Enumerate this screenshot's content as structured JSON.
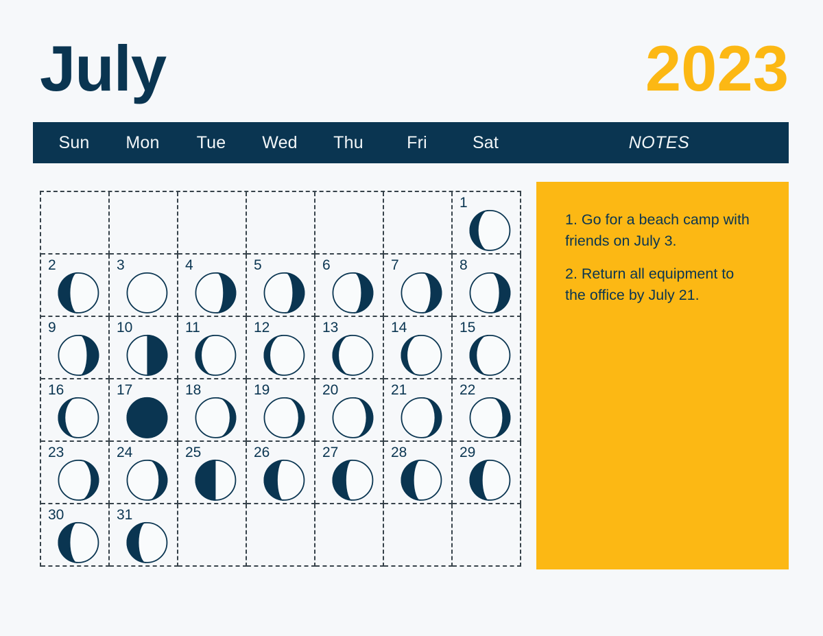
{
  "header": {
    "month": "July",
    "year": "2023",
    "notes_label": "NOTES",
    "weekdays": [
      "Sun",
      "Mon",
      "Tue",
      "Wed",
      "Thu",
      "Fri",
      "Sat"
    ]
  },
  "colors": {
    "navy": "#0a3551",
    "amber": "#fcb814",
    "background": "#f6f8fa",
    "grid_line": "#36424a"
  },
  "notes": {
    "items": [
      "1. Go for a beach camp with friends on July 3.",
      "2. Return all equipment to the office by July 21."
    ]
  },
  "calendar": {
    "leading_blanks": 6,
    "trailing_blanks": 5,
    "days": [
      {
        "num": "1",
        "phase": "waning-crescent",
        "illumination": 0.22,
        "dark_side": "left"
      },
      {
        "num": "2",
        "phase": "waning-crescent",
        "illumination": 0.3,
        "dark_side": "left"
      },
      {
        "num": "3",
        "phase": "full-moon",
        "illumination": 1.0,
        "dark_side": "none"
      },
      {
        "num": "4",
        "phase": "waning-gibbous",
        "illumination": 0.32,
        "dark_side": "right"
      },
      {
        "num": "5",
        "phase": "waning-gibbous",
        "illumination": 0.3,
        "dark_side": "right"
      },
      {
        "num": "6",
        "phase": "waning-gibbous",
        "illumination": 0.3,
        "dark_side": "right"
      },
      {
        "num": "7",
        "phase": "waning-gibbous",
        "illumination": 0.28,
        "dark_side": "right"
      },
      {
        "num": "8",
        "phase": "waning-gibbous",
        "illumination": 0.28,
        "dark_side": "right"
      },
      {
        "num": "9",
        "phase": "waning-gibbous",
        "illumination": 0.3,
        "dark_side": "right"
      },
      {
        "num": "10",
        "phase": "last-quarter",
        "illumination": 0.5,
        "dark_side": "right"
      },
      {
        "num": "11",
        "phase": "waning-crescent",
        "illumination": 0.16,
        "dark_side": "left"
      },
      {
        "num": "12",
        "phase": "waning-crescent",
        "illumination": 0.16,
        "dark_side": "left"
      },
      {
        "num": "13",
        "phase": "waning-crescent",
        "illumination": 0.16,
        "dark_side": "left"
      },
      {
        "num": "14",
        "phase": "waning-crescent",
        "illumination": 0.16,
        "dark_side": "left"
      },
      {
        "num": "15",
        "phase": "waning-crescent",
        "illumination": 0.18,
        "dark_side": "left"
      },
      {
        "num": "16",
        "phase": "waning-crescent",
        "illumination": 0.18,
        "dark_side": "left"
      },
      {
        "num": "17",
        "phase": "new-moon",
        "illumination": 0.0,
        "dark_side": "all"
      },
      {
        "num": "18",
        "phase": "waxing-crescent",
        "illumination": 0.16,
        "dark_side": "right"
      },
      {
        "num": "19",
        "phase": "waxing-crescent",
        "illumination": 0.16,
        "dark_side": "right"
      },
      {
        "num": "20",
        "phase": "waxing-crescent",
        "illumination": 0.18,
        "dark_side": "right"
      },
      {
        "num": "21",
        "phase": "waxing-crescent",
        "illumination": 0.18,
        "dark_side": "right"
      },
      {
        "num": "22",
        "phase": "waxing-crescent",
        "illumination": 0.2,
        "dark_side": "right"
      },
      {
        "num": "23",
        "phase": "waxing-crescent",
        "illumination": 0.2,
        "dark_side": "right"
      },
      {
        "num": "24",
        "phase": "waxing-crescent",
        "illumination": 0.22,
        "dark_side": "right"
      },
      {
        "num": "25",
        "phase": "first-quarter",
        "illumination": 0.5,
        "dark_side": "left"
      },
      {
        "num": "26",
        "phase": "waxing-gibbous",
        "illumination": 0.34,
        "dark_side": "left"
      },
      {
        "num": "27",
        "phase": "waxing-gibbous",
        "illumination": 0.34,
        "dark_side": "left"
      },
      {
        "num": "28",
        "phase": "waxing-gibbous",
        "illumination": 0.32,
        "dark_side": "left"
      },
      {
        "num": "29",
        "phase": "waxing-gibbous",
        "illumination": 0.32,
        "dark_side": "left"
      },
      {
        "num": "30",
        "phase": "waxing-gibbous",
        "illumination": 0.3,
        "dark_side": "left"
      },
      {
        "num": "31",
        "phase": "waxing-gibbous",
        "illumination": 0.3,
        "dark_side": "left"
      }
    ]
  }
}
